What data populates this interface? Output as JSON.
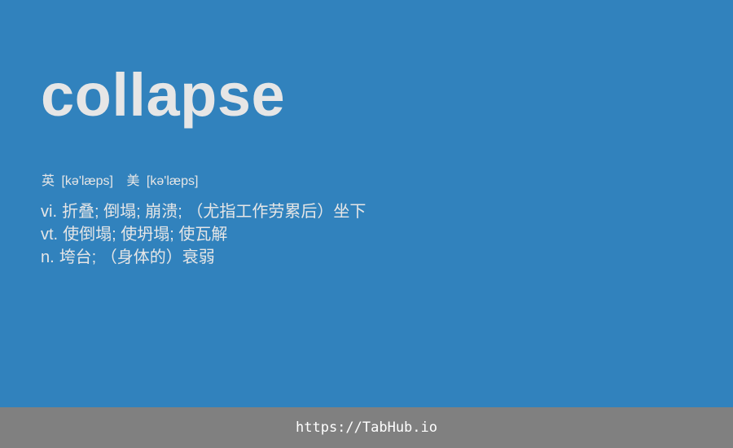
{
  "word": "collapse",
  "phonetics": {
    "uk": {
      "label": "英",
      "ipa": "[kə'læps]"
    },
    "us": {
      "label": "美",
      "ipa": "[kə'læps]"
    }
  },
  "definitions": [
    {
      "pos": "vi.",
      "meaning": "折叠; 倒塌; 崩溃; （尤指工作劳累后）坐下"
    },
    {
      "pos": "vt.",
      "meaning": "使倒塌; 使坍塌; 使瓦解"
    },
    {
      "pos": "n.",
      "meaning": "垮台; （身体的）衰弱"
    }
  ],
  "footer": {
    "url": "https://TabHub.io"
  },
  "colors": {
    "background": "#3182bd",
    "text": "#e6e6e6",
    "footer_bg": "#808080",
    "footer_text": "#ffffff"
  }
}
